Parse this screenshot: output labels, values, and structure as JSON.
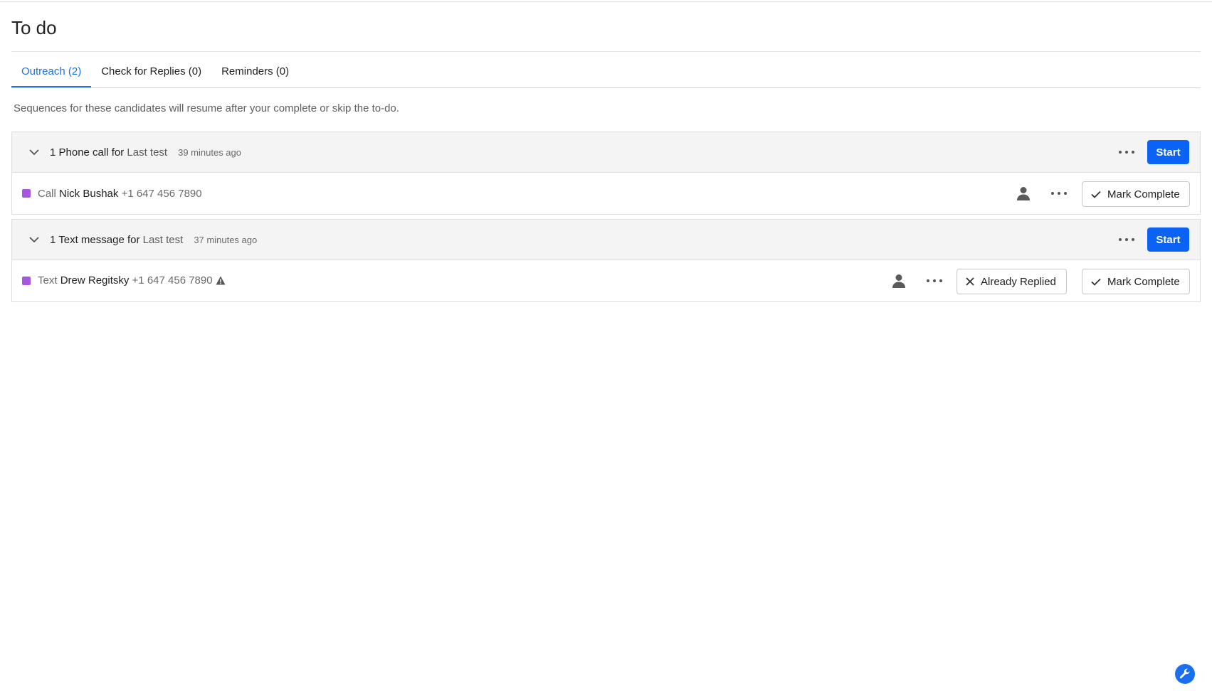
{
  "page": {
    "title": "To do"
  },
  "tabs": [
    {
      "label": "Outreach (2)",
      "active": true
    },
    {
      "label": "Check for Replies (0)",
      "active": false
    },
    {
      "label": "Reminders (0)",
      "active": false
    }
  ],
  "info_text": "Sequences for these candidates will resume after your complete or skip the to-do.",
  "groups": [
    {
      "count_type": "1 Phone call for",
      "sequence": "Last test",
      "time": "39 minutes ago",
      "start_label": "Start",
      "item": {
        "action": "Call",
        "name": "Nick Bushak",
        "phone": "+1 647 456 7890",
        "mark_complete_label": "Mark Complete"
      }
    },
    {
      "count_type": "1 Text message for",
      "sequence": "Last test",
      "time": "37 minutes ago",
      "start_label": "Start",
      "item": {
        "action": "Text",
        "name": "Drew Regitsky",
        "phone": "+1 647 456 7890",
        "already_replied_label": "Already Replied",
        "mark_complete_label": "Mark Complete"
      }
    }
  ],
  "colors": {
    "accent": "#0b63f6",
    "tab_active": "#1a73e8",
    "status_square": "#a855e0"
  }
}
